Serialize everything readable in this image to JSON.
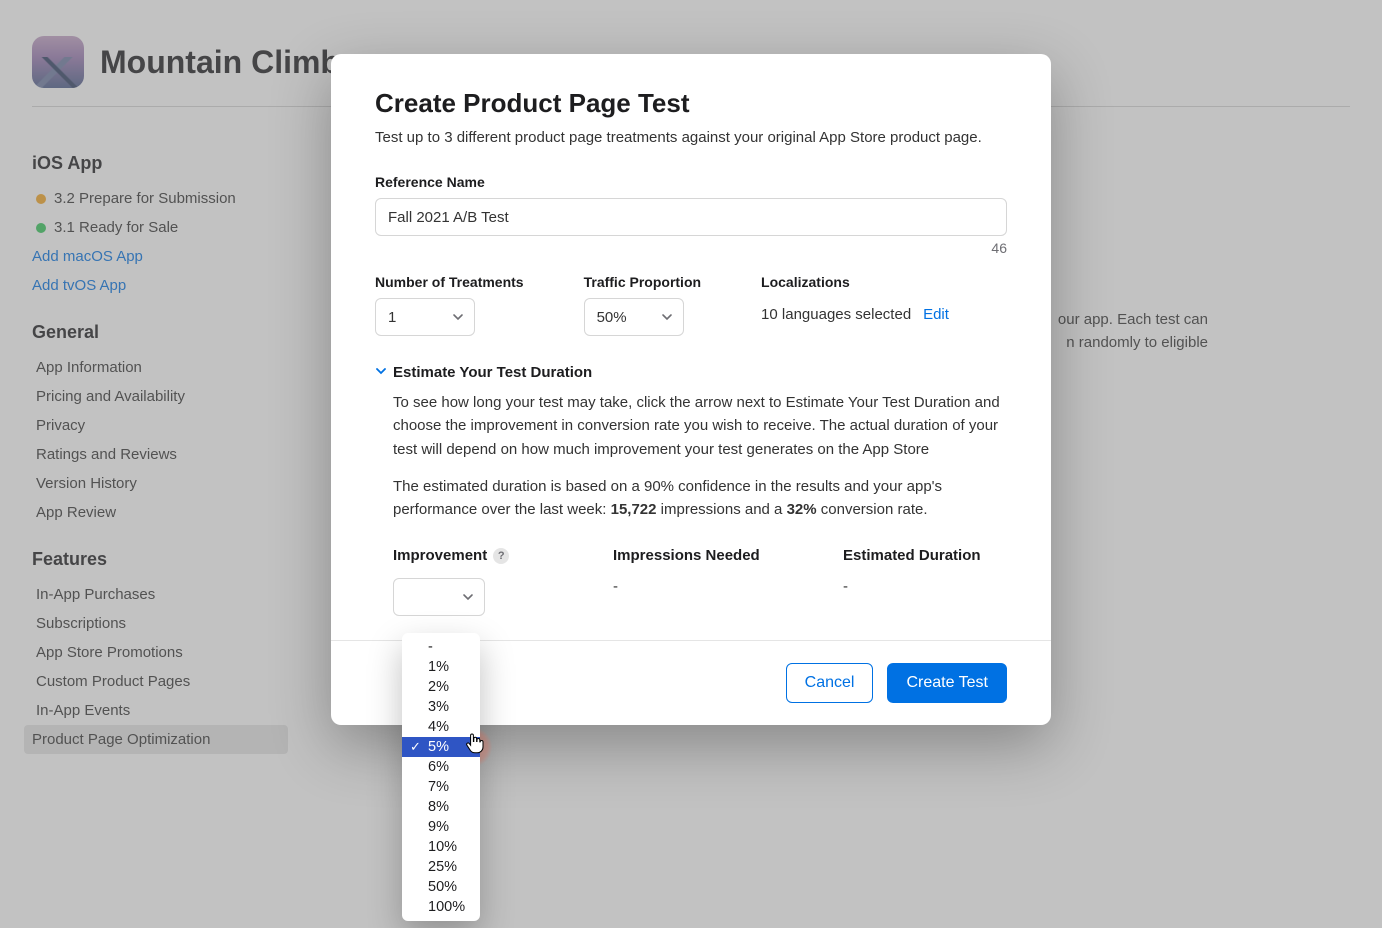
{
  "header": {
    "app_name": "Mountain Climber"
  },
  "sidebar": {
    "section_ios": "iOS App",
    "version_prepare": {
      "label": "3.2 Prepare for Submission"
    },
    "version_ready": {
      "label": "3.1 Ready for Sale"
    },
    "add_macos": "Add macOS App",
    "add_tvos": "Add tvOS App",
    "section_general": "General",
    "general_items": [
      "App Information",
      "Pricing and Availability",
      "Privacy",
      "Ratings and Reviews",
      "Version History",
      "App Review"
    ],
    "section_features": "Features",
    "feature_items": [
      "In-App Purchases",
      "Subscriptions",
      "App Store Promotions",
      "Custom Product Pages",
      "In-App Events",
      "Product Page Optimization"
    ]
  },
  "main": {
    "background_text_1": "our app. Each test can",
    "background_text_2": "n randomly to eligible"
  },
  "modal": {
    "title": "Create Product Page Test",
    "subtitle": "Test up to 3 different product page treatments against your original App Store product page.",
    "reference_name_label": "Reference Name",
    "reference_name_value": "Fall 2021 A/B Test",
    "reference_name_count": "46",
    "treatments_label": "Number of Treatments",
    "treatments_value": "1",
    "traffic_label": "Traffic Proportion",
    "traffic_value": "50%",
    "localizations_label": "Localizations",
    "localizations_text": "10 languages selected",
    "localizations_edit": "Edit",
    "estimate_header": "Estimate Your Test Duration",
    "estimate_p1": "To see how long your test may take, click the arrow next to Estimate Your Test Duration and choose the improvement in conversion rate you wish to receive. The actual duration of your test will depend on how much improvement your test generates on the App Store",
    "estimate_p2_a": "The estimated duration is based on a 90% confidence in the results and your app's performance over the last week: ",
    "estimate_p2_impressions": "15,722",
    "estimate_p2_b": " impressions and a ",
    "estimate_p2_rate": "32%",
    "estimate_p2_c": " conversion rate.",
    "improvement_label": "Improvement",
    "impressions_label": "Impressions Needed",
    "duration_label": "Estimated Duration",
    "impressions_value": "-",
    "duration_value": "-",
    "cancel": "Cancel",
    "create": "Create Test"
  },
  "dropdown": {
    "options": [
      "-",
      "1%",
      "2%",
      "3%",
      "4%",
      "5%",
      "6%",
      "7%",
      "8%",
      "9%",
      "10%",
      "25%",
      "50%",
      "100%"
    ],
    "selected": "5%"
  }
}
